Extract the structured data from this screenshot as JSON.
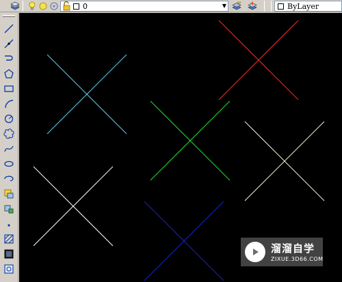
{
  "layer_toolbar": {
    "layer_name": "0",
    "color_value": "ByLayer",
    "icons": [
      "layer-manager-icon",
      "lightbulb-on-icon",
      "sun-freeze-icon",
      "viewport-freeze-icon",
      "padlock-unlock-icon",
      "color-swatch-icon",
      "make-object-layer-current-icon",
      "layer-previous-icon"
    ]
  },
  "draw_toolbar": {
    "tools": [
      "line-icon",
      "construction-line-icon",
      "polyline-icon",
      "polygon-icon",
      "rectangle-icon",
      "arc-icon",
      "circle-icon",
      "revision-cloud-icon",
      "spline-icon",
      "ellipse-icon",
      "ellipse-arc-icon",
      "insert-block-icon",
      "make-block-icon",
      "point-icon",
      "hatch-icon",
      "gradient-icon",
      "region-icon"
    ]
  },
  "drawing": {
    "background": "#000000",
    "crosses": [
      {
        "name": "cross-cyan",
        "color": "#66ccee",
        "a": [
          [
            69,
            80
          ],
          [
            185,
            196
          ]
        ],
        "b": [
          [
            185,
            80
          ],
          [
            69,
            196
          ]
        ]
      },
      {
        "name": "cross-red",
        "color": "#ff2a2a",
        "a": [
          [
            320,
            30
          ],
          [
            436,
            146
          ]
        ],
        "b": [
          [
            436,
            30
          ],
          [
            320,
            146
          ]
        ]
      },
      {
        "name": "cross-green",
        "color": "#22e03a",
        "a": [
          [
            220,
            148
          ],
          [
            336,
            264
          ]
        ],
        "b": [
          [
            336,
            148
          ],
          [
            220,
            264
          ]
        ]
      },
      {
        "name": "cross-yellow-white",
        "color": "#f3f3d2",
        "a": [
          [
            358,
            178
          ],
          [
            474,
            294
          ]
        ],
        "b": [
          [
            474,
            178
          ],
          [
            358,
            294
          ]
        ]
      },
      {
        "name": "cross-white",
        "color": "#ffffff",
        "a": [
          [
            49,
            244
          ],
          [
            165,
            360
          ]
        ],
        "b": [
          [
            165,
            244
          ],
          [
            49,
            360
          ]
        ]
      },
      {
        "name": "cross-blue",
        "color": "#1a22c8",
        "a": [
          [
            211,
            295
          ],
          [
            327,
            411
          ]
        ],
        "b": [
          [
            327,
            295
          ],
          [
            211,
            411
          ]
        ]
      }
    ]
  },
  "watermark": {
    "title": "溜溜自学",
    "subtitle": "ZIXUE.3D66.COM"
  }
}
